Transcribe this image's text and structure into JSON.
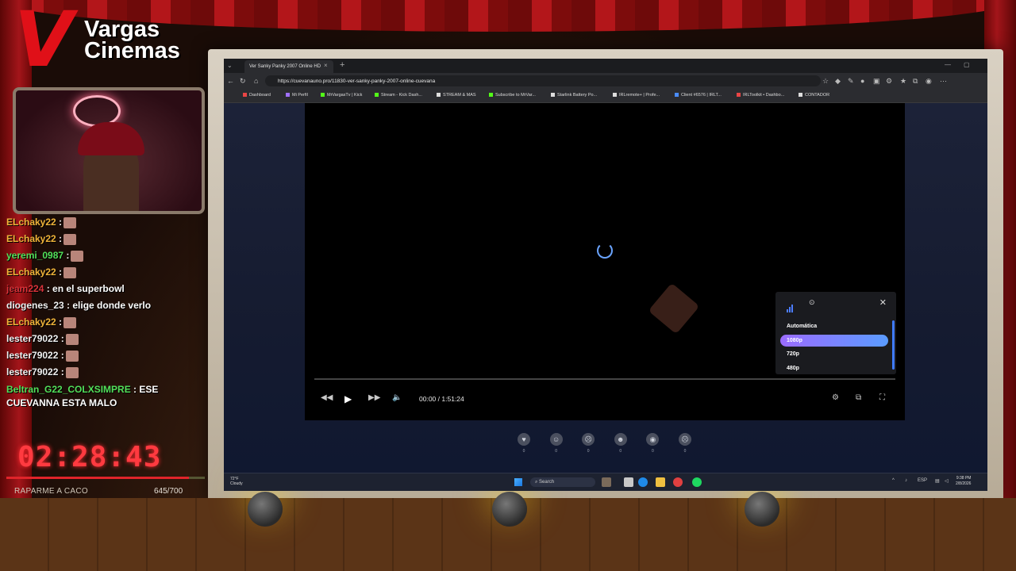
{
  "brand": {
    "logo_letter": "V",
    "line1": "Vargas",
    "line2": "Cinemas"
  },
  "chat": [
    {
      "user": "ELchaky22",
      "sep": " :",
      "text": "",
      "emote": true,
      "color": "orange"
    },
    {
      "user": "ELchaky22",
      "sep": " :",
      "text": "",
      "emote": true,
      "color": "orange"
    },
    {
      "user": "yeremi_0987",
      "sep": " :",
      "text": "",
      "emote": true,
      "color": "green"
    },
    {
      "user": "ELchaky22",
      "sep": " :",
      "text": "",
      "emote": true,
      "color": "orange"
    },
    {
      "user": "jeam224",
      "sep": " :",
      "text": " en el superbowl",
      "emote": false,
      "color": "red"
    },
    {
      "user": "diogenes_23",
      "sep": " :",
      "text": " elige donde verlo",
      "emote": false,
      "color": "white"
    },
    {
      "user": "ELchaky22",
      "sep": " :",
      "text": "",
      "emote": true,
      "color": "orange"
    },
    {
      "user": "lester79022",
      "sep": " :",
      "text": "",
      "emote": true,
      "color": "white"
    },
    {
      "user": "lester79022",
      "sep": " :",
      "text": "",
      "emote": true,
      "color": "white"
    },
    {
      "user": "lester79022",
      "sep": " :",
      "text": "",
      "emote": true,
      "color": "white"
    },
    {
      "user": "Beltran_G22_COLXSIMPRE",
      "sep": " :",
      "text": " ESE CUEVANNA ESTA MALO",
      "emote": false,
      "color": "green"
    }
  ],
  "timer": {
    "value": "02:28:43",
    "goal_label": "RAPARME A CACO",
    "goal_count": "645/700",
    "goal_progress": 0.92
  },
  "browser": {
    "tab_title": "Ver Sanky Panky 2007 Online HD",
    "tab_close": "×",
    "tab_new": "+",
    "url": "https://cuevanauno.pro/11830-ver-sanky-panky-2007-online-cuevana",
    "win_min": "—",
    "win_max": "▢",
    "bookmarks": [
      {
        "label": "Dashboard",
        "color": "#e94545"
      },
      {
        "label": "Mi Perfil",
        "color": "#a070ff"
      },
      {
        "label": "MrVargasTv | Kick",
        "color": "#53fc18"
      },
      {
        "label": "Stream - Kick Dash...",
        "color": "#53fc18"
      },
      {
        "label": "STREAM & MAS",
        "color": "#dddddd"
      },
      {
        "label": "Subscribe to MrVar...",
        "color": "#53fc18"
      },
      {
        "label": "Starlink Battery Po...",
        "color": "#dddddd"
      },
      {
        "label": "IRLremote+ | Profe...",
        "color": "#dddddd"
      },
      {
        "label": "Client #6576 | IRLT...",
        "color": "#4a8cff"
      },
      {
        "label": "IRLToolkit • Dashbo...",
        "color": "#e94545"
      },
      {
        "label": "CONTADOR",
        "color": "#dddddd"
      }
    ]
  },
  "player": {
    "current_time": "00:00",
    "separator": "/",
    "duration": "1:51:24",
    "quality_options": [
      {
        "label": "Automática",
        "active": false
      },
      {
        "label": "1080p",
        "active": true
      },
      {
        "label": "720p",
        "active": false
      },
      {
        "label": "480p",
        "active": false
      }
    ]
  },
  "reactions": [
    {
      "icon": "♥",
      "count": "0"
    },
    {
      "icon": "☺",
      "count": "0"
    },
    {
      "icon": "☹",
      "count": "0"
    },
    {
      "icon": "☻",
      "count": "0"
    },
    {
      "icon": "◉",
      "count": "0"
    },
    {
      "icon": "☹",
      "count": "0"
    }
  ],
  "taskbar": {
    "temp": "72°F",
    "weather": "Cloudy",
    "search": "Search",
    "lang": "ESP",
    "time": "9:38 PM",
    "date": "2/8/2026"
  }
}
